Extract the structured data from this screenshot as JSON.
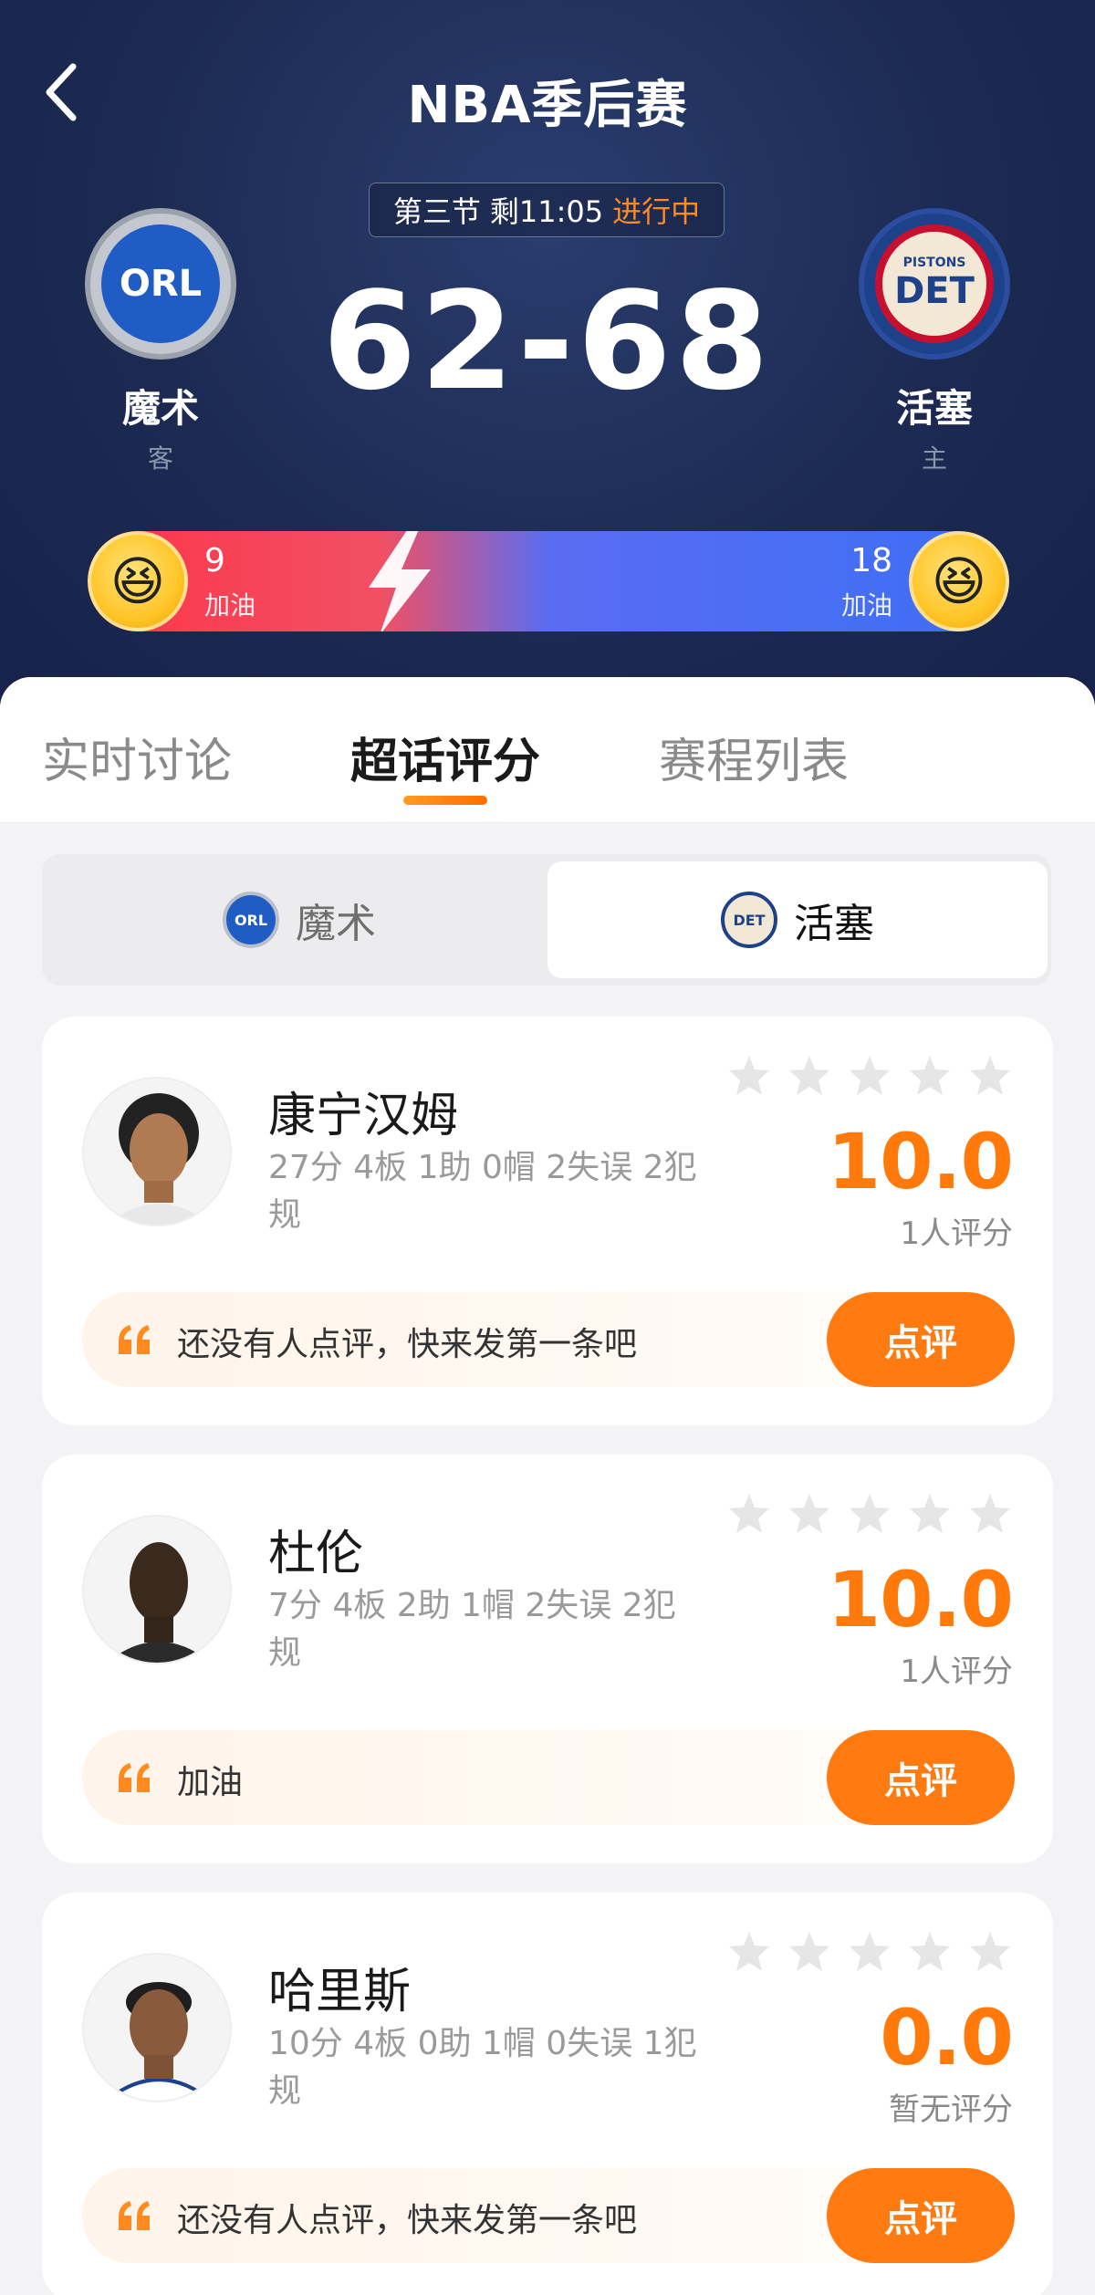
{
  "header": {
    "title": "NBA季后赛",
    "status": {
      "period": "第三节",
      "remaining": "剩11:05",
      "state": "进行中"
    },
    "score": "62-68",
    "away_team": {
      "name": "魔术",
      "role": "客",
      "logo_text": "ORL"
    },
    "home_team": {
      "name": "活塞",
      "role": "主",
      "logo_text": "DET",
      "logo_subtext": "PISTONS"
    },
    "cheer": {
      "away_count": "9",
      "away_label": "加油",
      "home_count": "18",
      "home_label": "加油"
    }
  },
  "tabs": [
    {
      "label": "实时讨论"
    },
    {
      "label": "超话评分"
    },
    {
      "label": "赛程列表"
    }
  ],
  "team_switch": [
    {
      "label": "魔术",
      "logo_text": "ORL"
    },
    {
      "label": "活塞",
      "logo_text": "DET"
    }
  ],
  "players": [
    {
      "name": "康宁汉姆",
      "stats": "27分 4板 1助 0帽 2失误 2犯规",
      "stars": 0,
      "rating": "10.0",
      "rating_count": "1人评分",
      "comment": "还没有人点评，快来发第一条吧",
      "button": "点评"
    },
    {
      "name": "杜伦",
      "stats": "7分 4板 2助 1帽 2失误 2犯规",
      "stars": 0,
      "rating": "10.0",
      "rating_count": "1人评分",
      "comment": "加油",
      "button": "点评"
    },
    {
      "name": "哈里斯",
      "stats": "10分 4板 0助 1帽 0失误 1犯规",
      "stars": 0,
      "rating": "0.0",
      "rating_count": "暂无评分",
      "comment": "还没有人点评，快来发第一条吧",
      "button": "点评"
    }
  ],
  "colors": {
    "accent": "#ff7a10",
    "header_bg": "#1c2a52",
    "cheer_away": "#ff3448",
    "cheer_home": "#3c6ff4"
  }
}
